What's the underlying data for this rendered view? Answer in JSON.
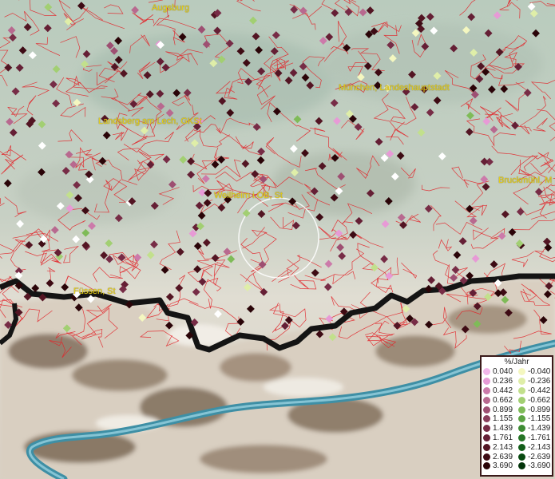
{
  "map": {
    "cities": [
      {
        "name": "Augsburg"
      },
      {
        "name": "München, Landeshauptstadt"
      },
      {
        "name": "Landsberg am Lech, GKSt"
      },
      {
        "name": "Bruckmühl, M"
      },
      {
        "name": "Weilheim i.OB, St"
      },
      {
        "name": "Füssen, St"
      }
    ],
    "legend": {
      "title": "%/Jahr",
      "positive": [
        {
          "label": "0.040",
          "color": "#f2b6ea"
        },
        {
          "label": "0.236",
          "color": "#e79ad6"
        },
        {
          "label": "0.442",
          "color": "#cc7aaa"
        },
        {
          "label": "0.662",
          "color": "#b8698f"
        },
        {
          "label": "0.899",
          "color": "#9e4f72"
        },
        {
          "label": "1.155",
          "color": "#8a3d5b"
        },
        {
          "label": "1.439",
          "color": "#772c46"
        },
        {
          "label": "1.761",
          "color": "#651f35"
        },
        {
          "label": "2.143",
          "color": "#531523"
        },
        {
          "label": "2.639",
          "color": "#3e0b14"
        },
        {
          "label": "3.690",
          "color": "#2a0408"
        }
      ],
      "negative": [
        {
          "label": "-0.040",
          "color": "#f4f7c0"
        },
        {
          "label": "-0.236",
          "color": "#dfeea8"
        },
        {
          "label": "-0.442",
          "color": "#c2e08c"
        },
        {
          "label": "-0.662",
          "color": "#a2cf72"
        },
        {
          "label": "-0.899",
          "color": "#7fbb58"
        },
        {
          "label": "-1.155",
          "color": "#5ca444"
        },
        {
          "label": "-1.439",
          "color": "#3e8c34"
        },
        {
          "label": "-1.761",
          "color": "#267526"
        },
        {
          "label": "-2.143",
          "color": "#135e1a"
        },
        {
          "label": "-2.639",
          "color": "#094a11"
        },
        {
          "label": "-3.690",
          "color": "#03340a"
        }
      ]
    }
  }
}
